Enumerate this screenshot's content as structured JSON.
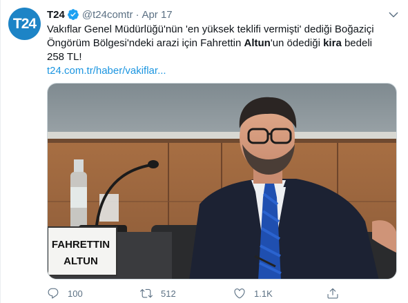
{
  "tweet": {
    "avatar_text": "T24",
    "name": "T24",
    "handle": "@t24comtr",
    "separator": "·",
    "date": "Apr 17",
    "text_part1": "Vakıflar Genel Müdürlüğü'nün 'en yüksek teklifi vermişti' dediği Boğaziçi Öngörüm Bölgesi'ndeki arazi için Fahrettin ",
    "text_bold1": "Altun",
    "text_part2": "'un ödediği ",
    "text_bold2": "kira",
    "text_part3": " bedeli 258 TL!",
    "link": "t24.com.tr/haber/vakiflar...",
    "image": {
      "nameplate_line1": "FAHRETTIN",
      "nameplate_line2": "ALTUN"
    },
    "actions": {
      "reply_count": "100",
      "retweet_count": "512",
      "like_count": "1.1K"
    }
  },
  "colors": {
    "accent": "#1da1f2",
    "link": "#1b95e0",
    "secondary_text": "#5b7083",
    "avatar_bg": "#1d84c6"
  }
}
